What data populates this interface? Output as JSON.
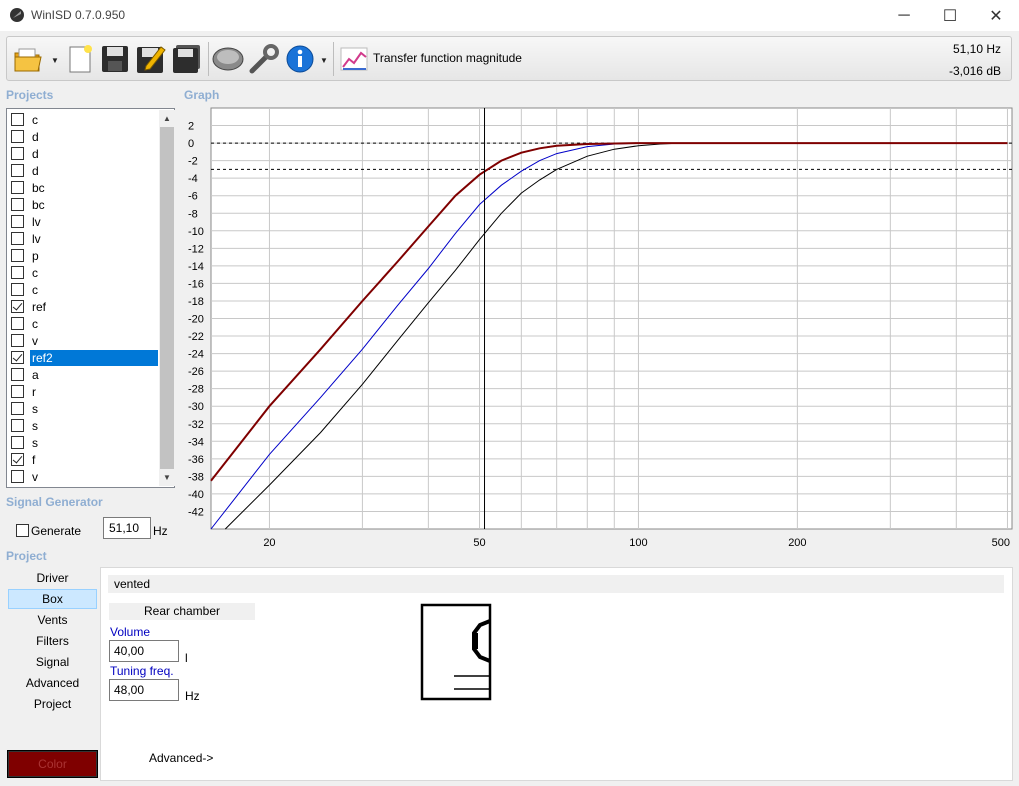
{
  "window": {
    "title": "WinISD 0.7.0.950",
    "minimize": "─",
    "maximize": "☐",
    "close": "✕"
  },
  "toolbar": {
    "icons": [
      "open-folder-icon",
      "new-project-icon",
      "save-icon",
      "save-as-icon",
      "save-all-icon",
      "driver-icon",
      "tools-icon",
      "info-icon",
      "graph-type-icon"
    ],
    "graph_type_label": "Transfer function magnitude",
    "cursor_freq": "51,10 Hz",
    "cursor_level": "-3,016 dB"
  },
  "sections": {
    "projects": "Projects",
    "graph": "Graph",
    "signal_generator": "Signal Generator",
    "project": "Project"
  },
  "projects": [
    {
      "name": "c",
      "checked": false
    },
    {
      "name": "d",
      "checked": false
    },
    {
      "name": "d",
      "checked": false
    },
    {
      "name": "d",
      "checked": false
    },
    {
      "name": "bc",
      "checked": false
    },
    {
      "name": "bc",
      "checked": false
    },
    {
      "name": "lv",
      "checked": false
    },
    {
      "name": "lv",
      "checked": false
    },
    {
      "name": "p",
      "checked": false
    },
    {
      "name": "c",
      "checked": false
    },
    {
      "name": "c",
      "checked": false
    },
    {
      "name": "ref",
      "checked": true
    },
    {
      "name": "c",
      "checked": false
    },
    {
      "name": "v",
      "checked": false
    },
    {
      "name": "ref2",
      "checked": true,
      "selected": true
    },
    {
      "name": "a",
      "checked": false
    },
    {
      "name": "r",
      "checked": false
    },
    {
      "name": "s",
      "checked": false
    },
    {
      "name": "s",
      "checked": false
    },
    {
      "name": "s",
      "checked": false
    },
    {
      "name": "f",
      "checked": true
    },
    {
      "name": "v",
      "checked": false
    }
  ],
  "signal_generator": {
    "generate_label": "Generate",
    "generate_checked": false,
    "frequency": "51,10",
    "unit": "Hz"
  },
  "project_nav": [
    {
      "label": "Driver",
      "active": false
    },
    {
      "label": "Box",
      "active": true
    },
    {
      "label": "Vents",
      "active": false
    },
    {
      "label": "Filters",
      "active": false
    },
    {
      "label": "Signal",
      "active": false
    },
    {
      "label": "Advanced",
      "active": false
    },
    {
      "label": "Project",
      "active": false
    }
  ],
  "color_button": "Color",
  "box": {
    "type": "vented",
    "rear_chamber": "Rear chamber",
    "volume_label": "Volume",
    "volume": "40,00",
    "volume_unit": "l",
    "tuning_label": "Tuning freq.",
    "tuning": "48,00",
    "tuning_unit": "Hz",
    "advanced": "Advanced->"
  },
  "colors": {
    "accent": "#0078d7",
    "section": "#8faed2",
    "ref2": "#7f0000",
    "ref": "#0000c8",
    "f": "#000000"
  },
  "chart_data": {
    "type": "line",
    "title": "",
    "xlabel": "",
    "ylabel": "",
    "x_scale": "log",
    "xlim": [
      15.5,
      510
    ],
    "ylim": [
      -44,
      4
    ],
    "x_ticks": [
      20,
      50,
      100,
      200,
      500
    ],
    "y_ticks": [
      2,
      0,
      -2,
      -4,
      -6,
      -8,
      -10,
      -12,
      -14,
      -16,
      -18,
      -20,
      -22,
      -24,
      -26,
      -28,
      -30,
      -32,
      -34,
      -36,
      -38,
      -40,
      -42
    ],
    "grid": true,
    "cursor": {
      "x": 51.1,
      "y": -3.016
    },
    "reference_lines_y": [
      0,
      -3
    ],
    "series": [
      {
        "name": "ref2",
        "color": "#7f0000",
        "points": [
          [
            15.5,
            -38.5
          ],
          [
            20,
            -30
          ],
          [
            25,
            -23.5
          ],
          [
            30,
            -18
          ],
          [
            35,
            -13.5
          ],
          [
            40,
            -9.5
          ],
          [
            45,
            -6
          ],
          [
            50,
            -3.6
          ],
          [
            55,
            -2.0
          ],
          [
            60,
            -1.1
          ],
          [
            65,
            -0.6
          ],
          [
            70,
            -0.3
          ],
          [
            80,
            -0.1
          ],
          [
            100,
            0
          ],
          [
            500,
            0
          ]
        ]
      },
      {
        "name": "ref",
        "color": "#0000c8",
        "points": [
          [
            15.5,
            -44
          ],
          [
            20,
            -35.5
          ],
          [
            25,
            -29
          ],
          [
            30,
            -23.5
          ],
          [
            35,
            -18.5
          ],
          [
            40,
            -14.3
          ],
          [
            45,
            -10.3
          ],
          [
            50,
            -7
          ],
          [
            55,
            -4.8
          ],
          [
            60,
            -3.2
          ],
          [
            65,
            -2
          ],
          [
            70,
            -1.2
          ],
          [
            80,
            -0.4
          ],
          [
            90,
            -0.1
          ],
          [
            100,
            0
          ],
          [
            500,
            0
          ]
        ]
      },
      {
        "name": "f",
        "color": "#000000",
        "points": [
          [
            16.5,
            -44
          ],
          [
            20,
            -39
          ],
          [
            25,
            -33
          ],
          [
            30,
            -27.5
          ],
          [
            35,
            -22.5
          ],
          [
            40,
            -18.2
          ],
          [
            45,
            -14.5
          ],
          [
            50,
            -11
          ],
          [
            55,
            -8
          ],
          [
            60,
            -5.7
          ],
          [
            65,
            -4.2
          ],
          [
            70,
            -3
          ],
          [
            80,
            -1.5
          ],
          [
            90,
            -0.7
          ],
          [
            100,
            -0.3
          ],
          [
            110,
            -0.1
          ],
          [
            120,
            0
          ],
          [
            500,
            0
          ]
        ]
      }
    ]
  }
}
